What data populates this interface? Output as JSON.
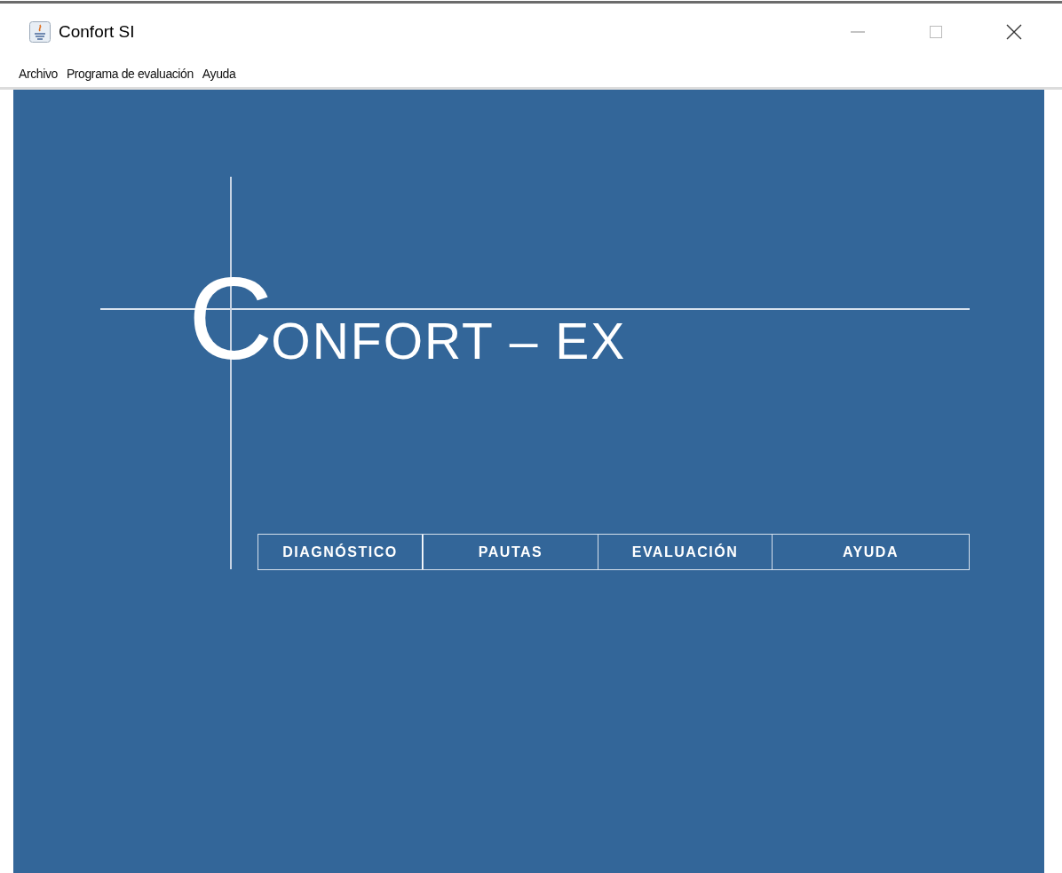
{
  "window": {
    "title": "Confort SI"
  },
  "menu": [
    "Archivo",
    "Programa de evaluación",
    "Ayuda"
  ],
  "logo": {
    "initial": "C",
    "rest": "ONFORT – EX"
  },
  "buttons": [
    "DIAGNÓSTICO",
    "PAUTAS",
    "EVALUACIÓN",
    "AYUDA"
  ]
}
